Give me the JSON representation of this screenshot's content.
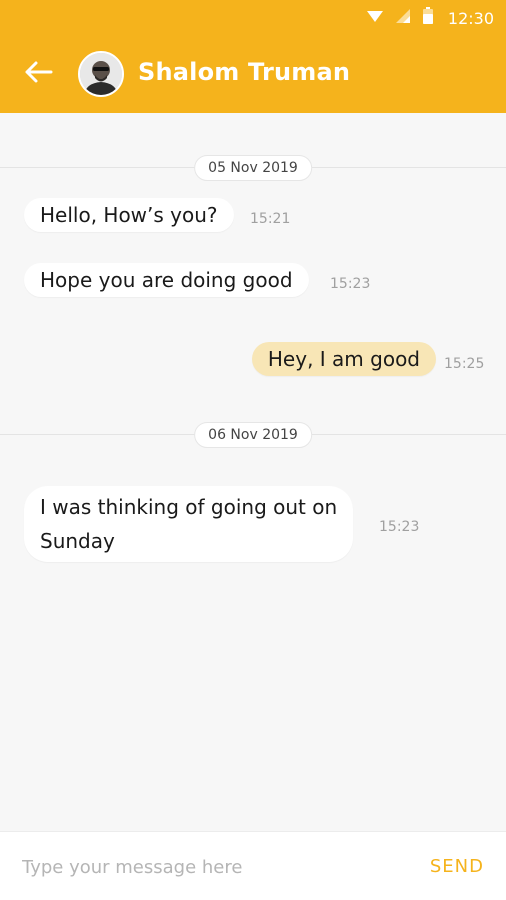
{
  "status_bar": {
    "time": "12:30",
    "icons": [
      "wifi-icon",
      "signal-icon",
      "battery-icon"
    ]
  },
  "header": {
    "contact_name": "Shalom Truman",
    "back_icon": "arrow-left-icon",
    "avatar_icon": "user-avatar"
  },
  "colors": {
    "accent": "#f5b31c",
    "outgoing_bubble": "#f8e6b6",
    "incoming_bubble": "#ffffff",
    "background": "#f7f7f7"
  },
  "conversation": {
    "date_separators": [
      {
        "label": "05 Nov 2019"
      },
      {
        "label": "06 Nov 2019"
      }
    ],
    "messages": [
      {
        "direction": "incoming",
        "text": "Hello, How’s you?",
        "time": "15:21"
      },
      {
        "direction": "incoming",
        "text": "Hope you are doing good",
        "time": "15:23"
      },
      {
        "direction": "outgoing",
        "text": "Hey, I am good",
        "time": "15:25"
      },
      {
        "direction": "incoming",
        "text_line1": "I was thinking of going out on",
        "text_line2": "Sunday",
        "time": "15:23"
      }
    ]
  },
  "composer": {
    "placeholder": "Type your message here",
    "value": "",
    "send_label": "SEND"
  }
}
